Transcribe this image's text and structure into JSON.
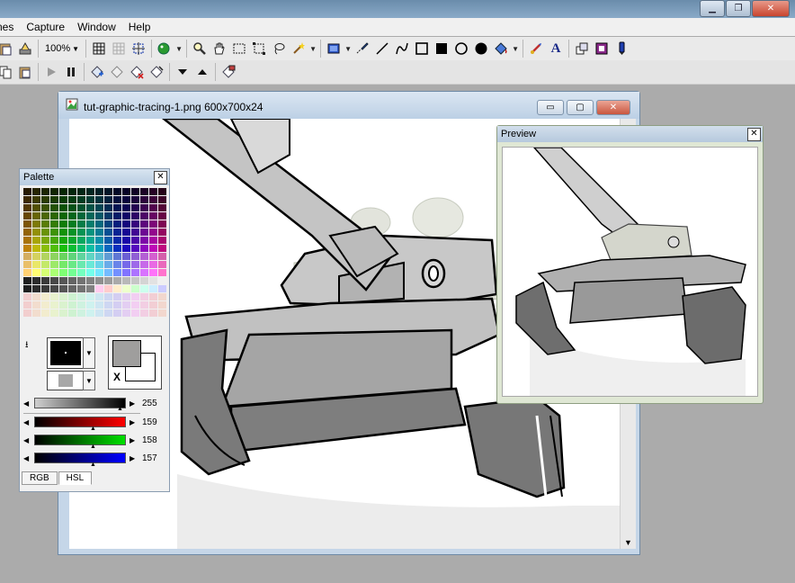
{
  "menubar": {
    "items": [
      "nes",
      "Capture",
      "Window",
      "Help"
    ]
  },
  "toolbar": {
    "zoom_value": "100%",
    "text_tool_label": "A"
  },
  "document": {
    "title": "tut-graphic-tracing-1.png 600x700x24",
    "minimize_label": "▭",
    "restore_label": "▢",
    "close_label": "✕"
  },
  "palette": {
    "title": "Palette",
    "close_label": "✕",
    "swap_label": "X",
    "sliders": [
      {
        "name": "brightness",
        "value": "255",
        "from": "#a8a8a8",
        "to": "#000000"
      },
      {
        "name": "red",
        "value": "159",
        "from": "#000000",
        "to": "#ff0000"
      },
      {
        "name": "green",
        "value": "158",
        "from": "#000000",
        "to": "#00e000"
      },
      {
        "name": "blue",
        "value": "157",
        "from": "#000000",
        "to": "#0000ff"
      }
    ],
    "tabs": [
      "RGB",
      "HSL"
    ],
    "foreground_color": "#000000",
    "background_color": "#9f9e9d"
  },
  "preview": {
    "title": "Preview",
    "close_label": "✕"
  },
  "colors": {
    "accent": "#6e8aa6",
    "canvas": "#ffffff",
    "workspace": "#ababab"
  }
}
